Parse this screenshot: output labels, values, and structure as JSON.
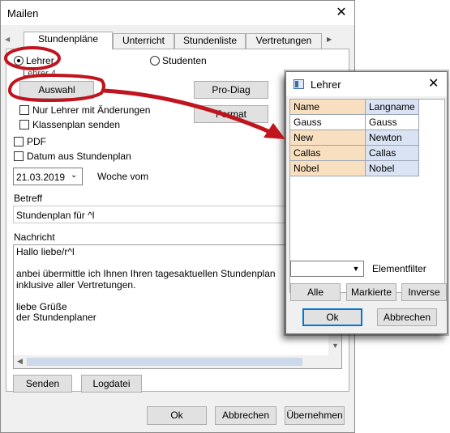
{
  "main_window": {
    "title": "Mailen",
    "close_glyph": "✕",
    "tabs": [
      "Stundenpläne",
      "Unterricht",
      "Stundenliste",
      "Vertretungen"
    ],
    "tab_scroll_left": "◀",
    "tab_scroll_right": "▶",
    "radio_lehrer": "Lehrer",
    "radio_studenten": "Studenten",
    "partial_label": "Lehrer 4",
    "auswahl_button": "Auswahl",
    "prodiag_button": "Pro-Diag",
    "format_button": "Format",
    "nur_lehrer_label": "Nur Lehrer mit Änderungen",
    "klassenplan_label": "Klassenplan senden",
    "pdf_label": "PDF",
    "datum_label": "Datum aus Stundenplan",
    "date_value": "21.03.2019",
    "woche_label": "Woche vom",
    "betreff_label": "Betreff",
    "betreff_value": "Stundenplan für ^l",
    "nachricht_label": "Nachricht",
    "nachricht_lines": [
      "Hallo liebe/r^l",
      "",
      "anbei übermittle ich Ihnen Ihren tagesaktuellen Stundenplan",
      "inklusive aller Vertretungen.",
      "",
      "liebe Grüße",
      "der Stundenplaner"
    ],
    "senden_button": "Senden",
    "logdatei_button": "Logdatei",
    "ok_button": "Ok",
    "abbrechen_button": "Abbrechen",
    "uebernehmen_button": "Übernehmen"
  },
  "lehrer_dialog": {
    "title": "Lehrer",
    "close_glyph": "✕",
    "columns": [
      "Name",
      "Langname"
    ],
    "rows": [
      [
        "Gauss",
        "Gauss"
      ],
      [
        "New",
        "Newton"
      ],
      [
        "Callas",
        "Callas"
      ],
      [
        "Nobel",
        "Nobel"
      ]
    ],
    "elementfilter_label": "Elementfilter",
    "alle_button": "Alle",
    "markierte_button": "Markierte",
    "inverse_button": "Inverse",
    "ok_button": "Ok",
    "abbrechen_button": "Abbrechen"
  },
  "colors": {
    "highlight_red": "#c0141e",
    "name_cell": "#f8dfbf",
    "langname_cell": "#d9e3f3",
    "accent_blue": "#0078d7"
  }
}
